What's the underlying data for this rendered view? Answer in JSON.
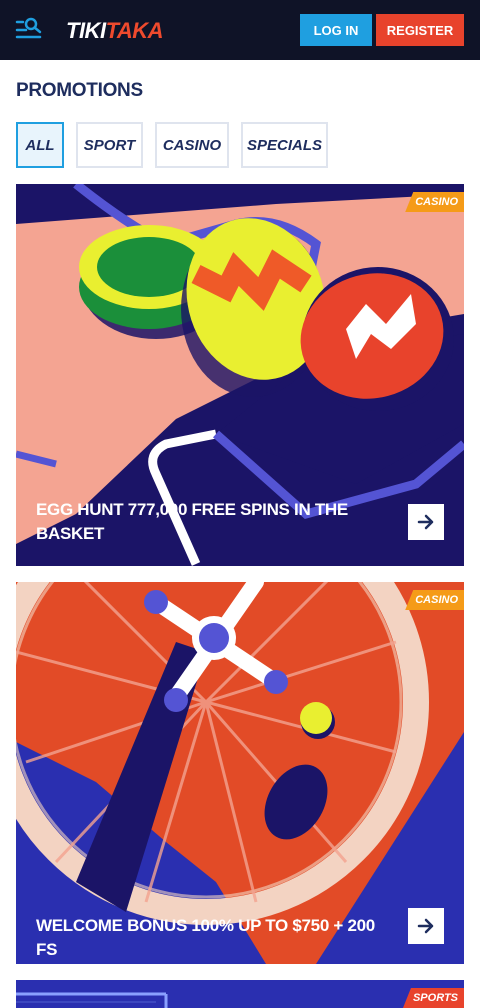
{
  "header": {
    "logo_part1": "TIKI",
    "logo_part2": "TAKA",
    "login_label": "LOG IN",
    "register_label": "REGISTER",
    "menu_icon": "menu-search-icon"
  },
  "page": {
    "title": "PROMOTIONS"
  },
  "filters": [
    {
      "label": "ALL",
      "active": true
    },
    {
      "label": "SPORT",
      "active": false
    },
    {
      "label": "CASINO",
      "active": false
    },
    {
      "label": "SPECIALS",
      "active": false
    }
  ],
  "promotions": [
    {
      "badge": "CASINO",
      "title": "EGG HUNT 777,000 FREE SPINS IN THE BASKET"
    },
    {
      "badge": "CASINO",
      "title": "WELCOME BONUS 100% UP TO $750 + 200 FS"
    },
    {
      "badge": "SPORTS",
      "title": ""
    }
  ],
  "colors": {
    "header_bg": "#0f1327",
    "login": "#1f9fe0",
    "register": "#e8432c",
    "casino_badge": "#f59b18",
    "sports_badge": "#e8432c"
  }
}
